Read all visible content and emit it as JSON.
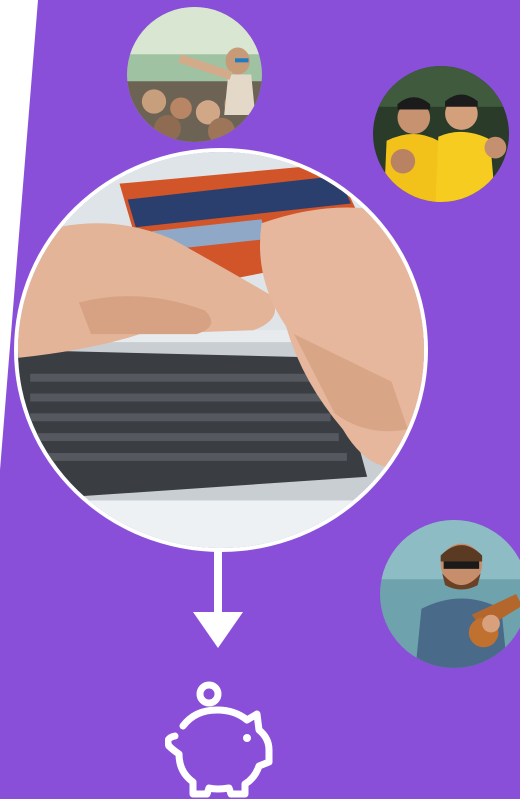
{
  "colors": {
    "background": "#ffffff",
    "panel": "#8a4fd9",
    "accent_line": "#ffffff"
  },
  "images": {
    "main": "laptop-credit-card-payment-photo",
    "top_left": "festival-crowd-photo",
    "top_right": "sports-fans-cheering-photo",
    "bottom_right": "guitarist-performing-photo"
  },
  "icons": {
    "flow_arrow": "arrow-down-icon",
    "savings": "piggy-bank-icon"
  }
}
